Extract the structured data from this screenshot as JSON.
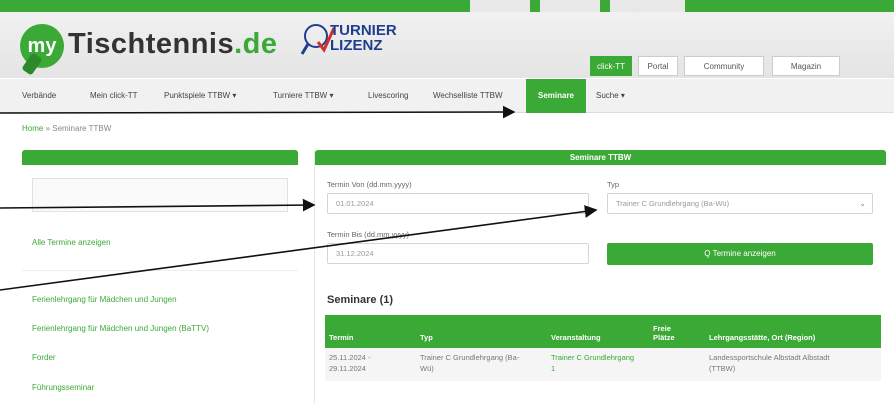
{
  "header": {
    "logo_my": "my",
    "logo_name": "Tischtennis",
    "logo_tld": ".de",
    "partner_logo": {
      "line1": "TURNIER",
      "line2": "LIZENZ"
    },
    "top_tabs": [
      {
        "label": "click-TT",
        "active": true
      },
      {
        "label": "Portal",
        "active": false
      },
      {
        "label": "Community",
        "active": false
      },
      {
        "label": "Magazin",
        "active": false
      }
    ]
  },
  "nav": {
    "items": [
      {
        "label": "Verbände"
      },
      {
        "label": "Mein click-TT"
      },
      {
        "label": "Punktspiele TTBW ▾"
      },
      {
        "label": "Turniere TTBW ▾"
      },
      {
        "label": "Livescoring"
      },
      {
        "label": "Wechselliste TTBW"
      },
      {
        "label": "Seminare",
        "active": true
      },
      {
        "label": "Suche ▾"
      }
    ]
  },
  "breadcrumb": {
    "home": "Home",
    "separator": "»",
    "current": "Seminare TTBW"
  },
  "left_panel": {
    "links": [
      "Alle Termine anzeigen",
      "Ferienlehrgang für Mädchen und Jungen",
      "Ferienlehrgang für Mädchen und Jungen (BaTTV)",
      "Forder",
      "Führungsseminar"
    ]
  },
  "right_panel": {
    "title": "Seminare TTBW",
    "from_label": "Termin Von (dd.mm.yyyy)",
    "from_value": "01.01.2024",
    "to_label": "Termin Bis (dd.mm.yyyy)",
    "to_value": "31.12.2024",
    "type_label": "Typ",
    "type_value": "Trainer C Grundlehrgang (Ba-Wü)",
    "show_button": "Q Termine anzeigen",
    "results_title": "Seminare (1)",
    "table": {
      "headers": [
        "Termin",
        "Typ",
        "Veranstaltung",
        "Freie Plätze",
        "Lehrgangsstätte, Ort (Region)"
      ],
      "rows": [
        {
          "termin": [
            "25.11.2024 -",
            "29.11.2024"
          ],
          "typ": [
            "Trainer C Grundlehrgang (Ba-",
            "Wü)"
          ],
          "veranstaltung": [
            "Trainer C Grundlehrgang",
            "1"
          ],
          "plaetze": "",
          "ort": [
            "Landessportschule Albstadt Albstadt",
            "(TTBW)"
          ]
        }
      ]
    }
  },
  "colors": {
    "brand_green": "#3aa935",
    "arrow": "#111111"
  }
}
